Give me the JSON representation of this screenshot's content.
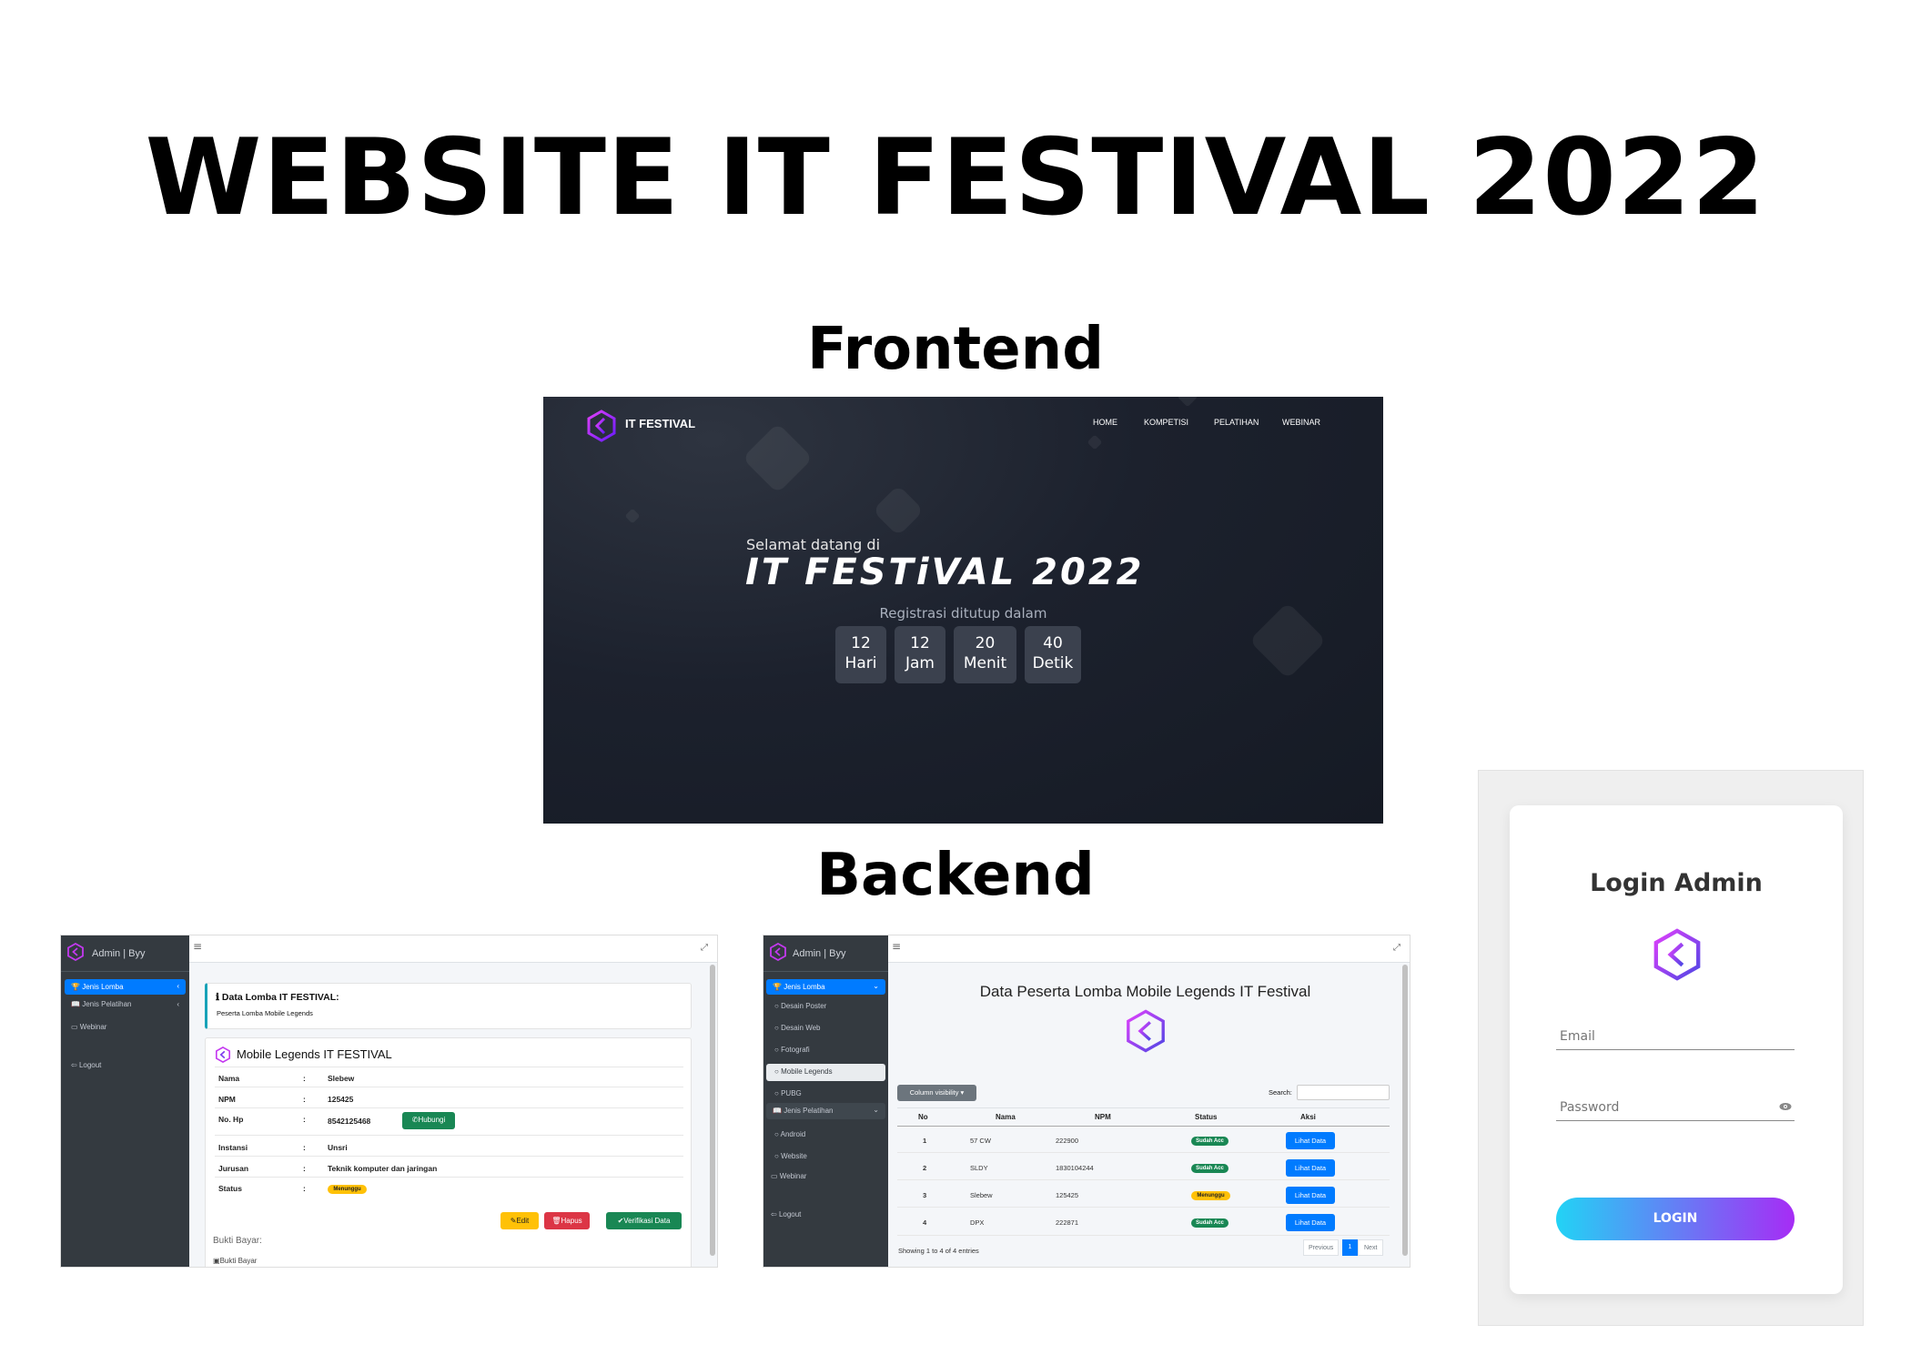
{
  "main_title": "WEBSITE IT FESTIVAL 2022",
  "frontend_title": "Frontend",
  "backend_title": "Backend",
  "frontend": {
    "brand": "IT FESTIVAL",
    "nav": [
      "HOME",
      "KOMPETISI",
      "PELATIHAN",
      "WEBINAR"
    ],
    "welcome": "Selamat datang di",
    "headline": "IT FESTiVAL 2022",
    "registration_note": "Registrasi ditutup dalam",
    "countdown": [
      {
        "value": "12",
        "unit": "Hari"
      },
      {
        "value": "12",
        "unit": "Jam"
      },
      {
        "value": "20",
        "unit": "Menit"
      },
      {
        "value": "40",
        "unit": "Detik"
      }
    ]
  },
  "backend_detail": {
    "brand": "Admin | Byy",
    "sidebar": {
      "jenis_lomba": "Jenis Lomba",
      "jenis_pelatihan": "Jenis Pelatihan",
      "webinar": "Webinar",
      "logout": "Logout"
    },
    "info_title": "Data Lomba IT FESTIVAL:",
    "info_sub": "Peserta Lomba Mobile Legends",
    "card_title": "Mobile Legends IT FESTIVAL",
    "fields": [
      {
        "label": "Nama",
        "value": "Slebew"
      },
      {
        "label": "NPM",
        "value": "125425"
      },
      {
        "label": "No. Hp",
        "value": "8542125468"
      },
      {
        "label": "Instansi",
        "value": "Unsri"
      },
      {
        "label": "Jurusan",
        "value": "Teknik komputer dan jaringan"
      },
      {
        "label": "Status",
        "value": "Menunggu"
      }
    ],
    "separator": ":",
    "hubungi_label": "Hubungi",
    "edit_label": "Edit",
    "hapus_label": "Hapus",
    "verifikasi_label": "Verifikasi Data",
    "bukti_label": "Bukti Bayar:",
    "bukti_img_alt": "Bukti Bayar"
  },
  "backend_list": {
    "brand": "Admin | Byy",
    "sidebar": {
      "jenis_lomba": "Jenis Lomba",
      "lomba_items": [
        "Desain Poster",
        "Desain Web",
        "Fotografi",
        "Mobile Legends",
        "PUBG"
      ],
      "jenis_pelatihan": "Jenis Pelatihan",
      "pelatihan_items": [
        "Android",
        "Website"
      ],
      "webinar": "Webinar",
      "logout": "Logout"
    },
    "page_title": "Data Peserta Lomba Mobile Legends IT Festival",
    "column_visibility": "Column visibility",
    "search_label": "Search:",
    "columns": [
      "No",
      "Nama",
      "NPM",
      "Status",
      "Aksi"
    ],
    "rows": [
      {
        "no": "1",
        "nama": "57 CW",
        "npm": "222900",
        "status": "Sudah Acc"
      },
      {
        "no": "2",
        "nama": "SLDY",
        "npm": "1830104244",
        "status": "Sudah Acc"
      },
      {
        "no": "3",
        "nama": "Slebew",
        "npm": "125425",
        "status": "Menunggu"
      },
      {
        "no": "4",
        "nama": "DPX",
        "npm": "222871",
        "status": "Sudah Acc"
      }
    ],
    "action_label": "Lihat Data",
    "showing": "Showing 1 to 4 of 4 entries",
    "prev": "Previous",
    "page": "1",
    "next": "Next"
  },
  "login": {
    "title": "Login Admin",
    "email_placeholder": "Email",
    "password_placeholder": "Password",
    "button": "LOGIN"
  },
  "colors": {
    "primary": "#007bff",
    "success": "#198754",
    "warning": "#ffc107",
    "danger": "#dc3545",
    "sidebar": "#343a40",
    "frontend_bg": "#1c212d",
    "login_gradient_start": "#22d3f5",
    "login_gradient_end": "#a62cf5"
  }
}
